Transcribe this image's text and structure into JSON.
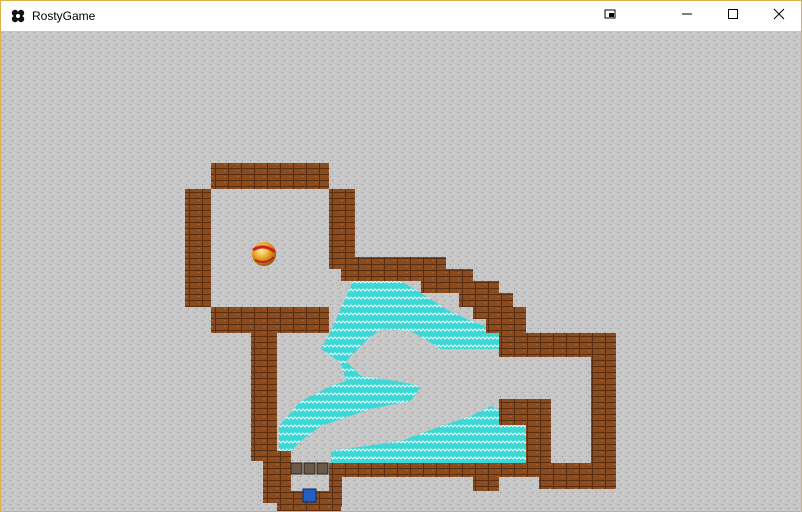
{
  "window": {
    "title": "RostyGame",
    "accent_color": "#d9b24a"
  },
  "titlebar": {
    "icons": [
      "app-icon",
      "compact-overlay-icon",
      "minimize-icon",
      "maximize-icon",
      "close-icon"
    ]
  },
  "game": {
    "colors": {
      "floor": "#c6c6c6",
      "wall": "#8a4b1e",
      "water": "#3fd6d6",
      "player": "#2060c0",
      "crate": "#6b5a48"
    },
    "objects": [
      "ball",
      "player-block",
      "crate-row"
    ]
  }
}
